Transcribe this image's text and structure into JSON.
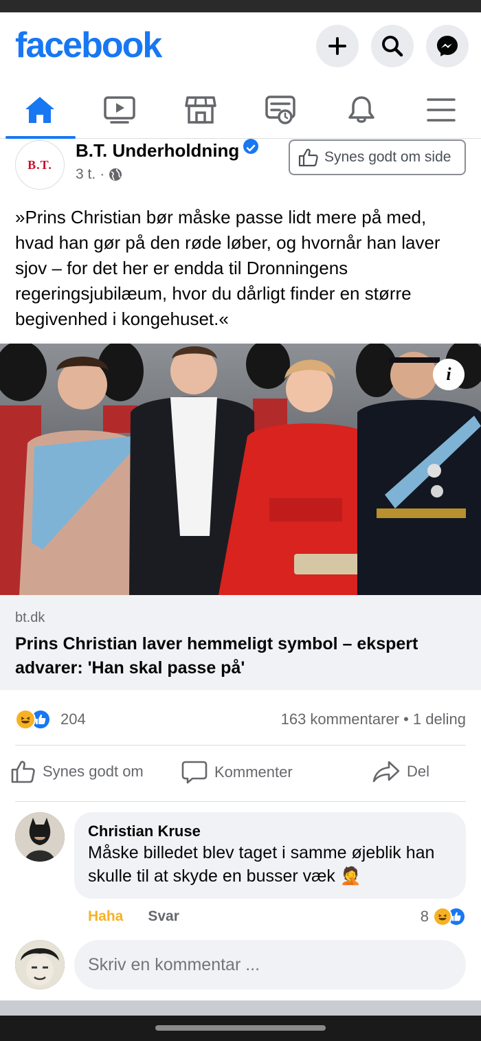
{
  "app": {
    "logo": "facebook",
    "brand_color": "#1877f2"
  },
  "header": {
    "buttons": [
      {
        "name": "add-button",
        "icon": "plus-icon"
      },
      {
        "name": "search-button",
        "icon": "search-icon"
      },
      {
        "name": "messenger-button",
        "icon": "messenger-icon"
      }
    ]
  },
  "tabs": [
    {
      "icon": "home-icon",
      "active": true
    },
    {
      "icon": "watch-icon",
      "active": false
    },
    {
      "icon": "marketplace-icon",
      "active": false
    },
    {
      "icon": "news-icon",
      "active": false
    },
    {
      "icon": "bell-icon",
      "active": false
    },
    {
      "icon": "menu-icon",
      "active": false
    }
  ],
  "post": {
    "page_avatar_text": "B.T.",
    "page_name": "B.T. Underholdning",
    "time": "3 t.",
    "visibility_icon": "globe-icon",
    "like_page_label": "Synes godt om side",
    "text": "»Prins Christian bør måske passe lidt mere på med, hvad han gør på den røde løber, og hvornår han laver sjov – for det her er endda til Dronningens regeringsjubilæum, hvor du dårligt finder en større begivenhed i kongehuset.«",
    "image_info": "i",
    "link": {
      "domain": "bt.dk",
      "title": "Prins Christian laver hemmeligt symbol – ekspert advarer: 'Han skal passe på'"
    },
    "reactions_count": "204",
    "comments_shares": "163 kommentarer • 1 deling",
    "actions": {
      "like": "Synes godt om",
      "comment": "Kommenter",
      "share": "Del"
    }
  },
  "comment": {
    "author": "Christian Kruse",
    "text": "Måske billedet blev taget i samme øjeblik han skulle til at skyde en busser væk 🤦",
    "haha": "Haha",
    "reply": "Svar",
    "reaction_count": "8"
  },
  "composer": {
    "placeholder": "Skriv en kommentar ..."
  }
}
